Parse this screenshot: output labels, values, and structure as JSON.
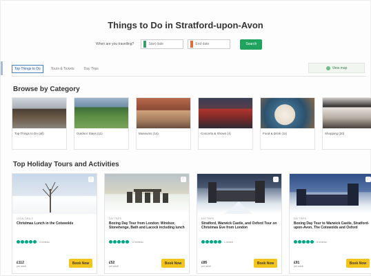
{
  "header": {
    "title": "Things to Do in Stratford-upon-Avon",
    "search_question": "When are you travelling?",
    "start_date_placeholder": "Start date",
    "end_date_placeholder": "End date",
    "search_button": "Search"
  },
  "tabs": [
    {
      "label": "Top Things to Do",
      "active": true
    },
    {
      "label": "Tours & Tickets",
      "active": false
    },
    {
      "label": "Day Trips",
      "active": false
    }
  ],
  "view_map_label": "View map",
  "categories_section": {
    "title": "Browse by Category",
    "items": [
      {
        "label": "Top Things to Do (all)"
      },
      {
        "label": "Outdoor Stays (11)"
      },
      {
        "label": "Museums (14)"
      },
      {
        "label": "Concerts & Shows (4)"
      },
      {
        "label": "Food & Drink (11)"
      },
      {
        "label": "Shopping (20)"
      }
    ]
  },
  "tours_section": {
    "title": "Top Holiday Tours and Activities",
    "book_label": "Book Now",
    "items": [
      {
        "category": "LOCAL DEALS",
        "name": "Christmas Lunch in the Cotswolds",
        "reviews": "5 reviews",
        "price": "£112",
        "per": "per adult"
      },
      {
        "category": "DAY TRIPS",
        "name": "Boxing Day Tour from London: Windsor, Stonehenge, Bath and Lacock including lunch",
        "reviews": "12 reviews",
        "price": "£52",
        "per": "per adult"
      },
      {
        "category": "DAY TRIPS",
        "name": "Stratford, Warwick Castle, and Oxford Tour on Christmas Eve from London",
        "reviews": "1 review",
        "price": "£85",
        "per": "per adult"
      },
      {
        "category": "DAY TRIPS",
        "name": "Boxing Day Tour to Warwick Castle, Stratford-upon-Avon, The Cotswolds and Oxford",
        "reviews": "8 reviews",
        "price": "£91",
        "per": "per adult"
      }
    ]
  },
  "colors": {
    "search_green": "#1fa35f",
    "book_yellow": "#f2c41c",
    "rating_green": "#00a680"
  }
}
